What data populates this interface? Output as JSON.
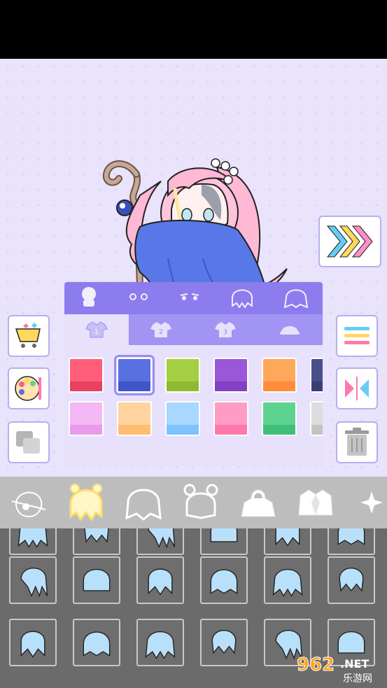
{
  "app": {
    "buttons": {
      "next": "next-arrows",
      "shop": "shop-cart",
      "palette": "color-palette",
      "layers": "layers",
      "menu": "menu-lines",
      "flip": "flip-horizontal",
      "trash": "trash-can"
    }
  },
  "panel": {
    "top_tabs": [
      "head-icon",
      "eyes-icon",
      "eyes-alt-icon",
      "hair-front-icon",
      "hair-back-icon"
    ],
    "color_tabs": [
      {
        "label": "1",
        "icon": "shirt-icon"
      },
      {
        "label": "2",
        "icon": "shirt-icon"
      },
      {
        "label": "3",
        "icon": "shirt-icon"
      },
      {
        "label": "",
        "icon": "cap-icon"
      }
    ],
    "active_color_tab": 0,
    "swatch_rows": [
      [
        {
          "top": "#ff5d7a",
          "bottom": "#e8405f"
        },
        {
          "top": "#5a6fe0",
          "bottom": "#3e56c9",
          "selected": true
        },
        {
          "top": "#a4cf43",
          "bottom": "#8fb833"
        },
        {
          "top": "#9a58d8",
          "bottom": "#8240c4"
        },
        {
          "top": "#ffa75a",
          "bottom": "#ff8c3a"
        },
        {
          "top": "#4a4f8a",
          "bottom": "#3a3e72"
        }
      ],
      [
        {
          "top": "#f4b8f5",
          "bottom": "#e79bea"
        },
        {
          "top": "#ffd4a0",
          "bottom": "#ffbd70"
        },
        {
          "top": "#a8d7ff",
          "bottom": "#7fc2ff"
        },
        {
          "top": "#ff9cc4",
          "bottom": "#ff78ac"
        },
        {
          "top": "#5ed391",
          "bottom": "#3fbf79"
        },
        {
          "top": "#dddddd",
          "bottom": "#c4c4c4"
        }
      ]
    ],
    "scroll_fraction": 0.1
  },
  "categories": [
    "face-accessory-icon",
    "hair-front-icon",
    "hair-back-icon",
    "bun-hair-icon",
    "hoodie-icon",
    "jacket-icon",
    "sparkle-icon"
  ],
  "active_category": 1,
  "colors": {
    "accent": "#8c7cee",
    "panel_light": "#e7e1fb",
    "hair_preview": "#b9e0fa"
  },
  "watermark": {
    "main": "962",
    "suffix": ".NET",
    "sub": "乐游网"
  }
}
